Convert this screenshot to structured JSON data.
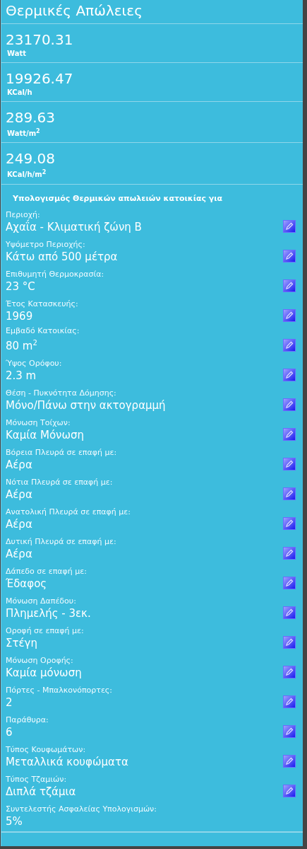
{
  "title": "Θερμικές Απώλειες",
  "results": [
    {
      "value": "23170.31",
      "unit": "Watt"
    },
    {
      "value": "19926.47",
      "unit": "KCal/h"
    },
    {
      "value": "289.63",
      "unit": "Watt/m$^{2}$"
    },
    {
      "value": "249.08",
      "unit": "KCal/h/m$^{2}$"
    }
  ],
  "section_heading": "Υπολογισμός Θερμικών απωλειών κατοικίας για",
  "fields": [
    {
      "label": "Περιοχή:",
      "value": "Αχαΐα - Κλιματική ζώνη Β",
      "editable": true
    },
    {
      "label": "Υψόμετρο Περιοχής:",
      "value": "Κάτω από 500 μέτρα",
      "editable": true
    },
    {
      "label": "Επιθυμητή Θερμοκρασία:",
      "value": "23 °C",
      "editable": true
    },
    {
      "label": "Έτος Κατασκευής:",
      "value": "1969",
      "editable": true
    },
    {
      "label": "Εμβαδό Κατοικίας:",
      "value": "80 m$^{2}$",
      "editable": true
    },
    {
      "label": "Ύψος Ορόφου:",
      "value": "2.3 m",
      "editable": true
    },
    {
      "label": "Θέση - Πυκνότητα Δόμησης:",
      "value": "Μόνο/Πάνω στην ακτογραμμή",
      "editable": true
    },
    {
      "label": "Μόνωση Τοίχων:",
      "value": "Καμία Μόνωση",
      "editable": true
    },
    {
      "label": "Βόρεια Πλευρά σε επαφή με:",
      "value": "Αέρα",
      "editable": true
    },
    {
      "label": "Νότια Πλευρά σε επαφή με:",
      "value": "Αέρα",
      "editable": true
    },
    {
      "label": "Ανατολική Πλευρά σε επαφή με:",
      "value": "Αέρα",
      "editable": true
    },
    {
      "label": "Δυτική Πλευρά σε επαφή με:",
      "value": "Αέρα",
      "editable": true
    },
    {
      "label": "Δάπεδο σε επαφή με:",
      "value": "Έδαφος",
      "editable": true
    },
    {
      "label": "Μόνωση Δαπέδου:",
      "value": "Πλημελής - 3εκ.",
      "editable": true
    },
    {
      "label": "Οροφή σε επαφή με:",
      "value": "Στέγη",
      "editable": true
    },
    {
      "label": "Μόνωση Οροφής:",
      "value": "Καμία μόνωση",
      "editable": true
    },
    {
      "label": "Πόρτες - Μπαλκονόπορτες:",
      "value": "2",
      "editable": true
    },
    {
      "label": "Παράθυρα:",
      "value": "6",
      "editable": true
    },
    {
      "label": "Τύπος Κουφωμάτων:",
      "value": "Μεταλλικά κουφώματα",
      "editable": true
    },
    {
      "label": "Τύπος Τζαμιών:",
      "value": "Διπλά τζάμια",
      "editable": true
    },
    {
      "label": "Συντελεστής Ασφαλείας Υπολογισμών:",
      "value": "5%",
      "editable": false
    }
  ]
}
